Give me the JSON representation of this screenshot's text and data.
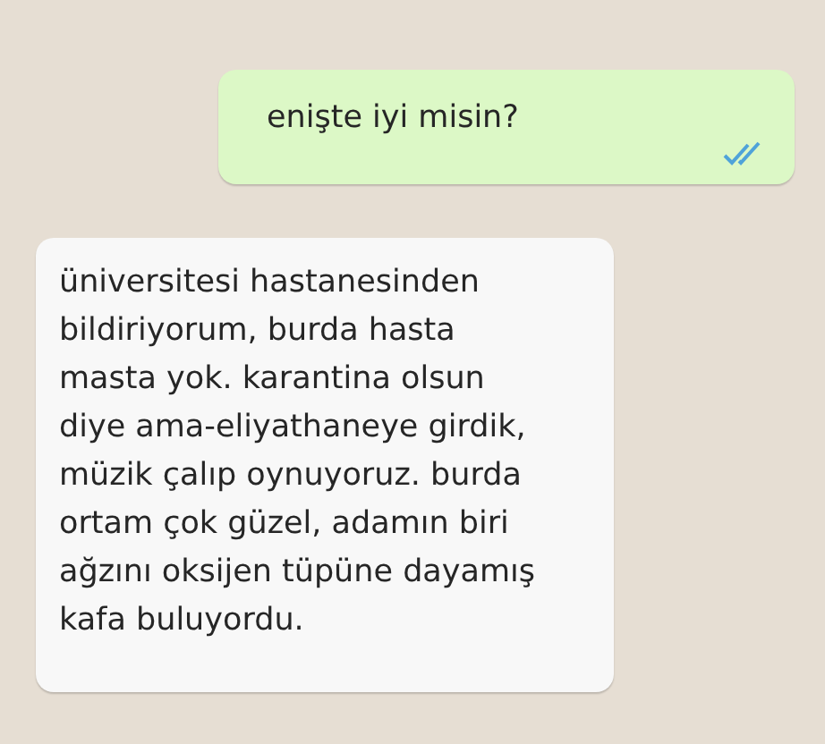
{
  "messages": [
    {
      "kind": "outgoing",
      "text": "enişte iyi misin?",
      "read": true
    },
    {
      "kind": "incoming",
      "text": "üniversitesi hastanesinden\nbildiriyorum, burda hasta\nmasta yok. karantina olsun\ndiye ama-eliyathaneye girdik,\nmüzik çalıp oynuyoruz. burda\nortam çok güzel, adamın biri\nağzını oksijen tüpüne dayamış\nkafa buluyordu."
    }
  ]
}
